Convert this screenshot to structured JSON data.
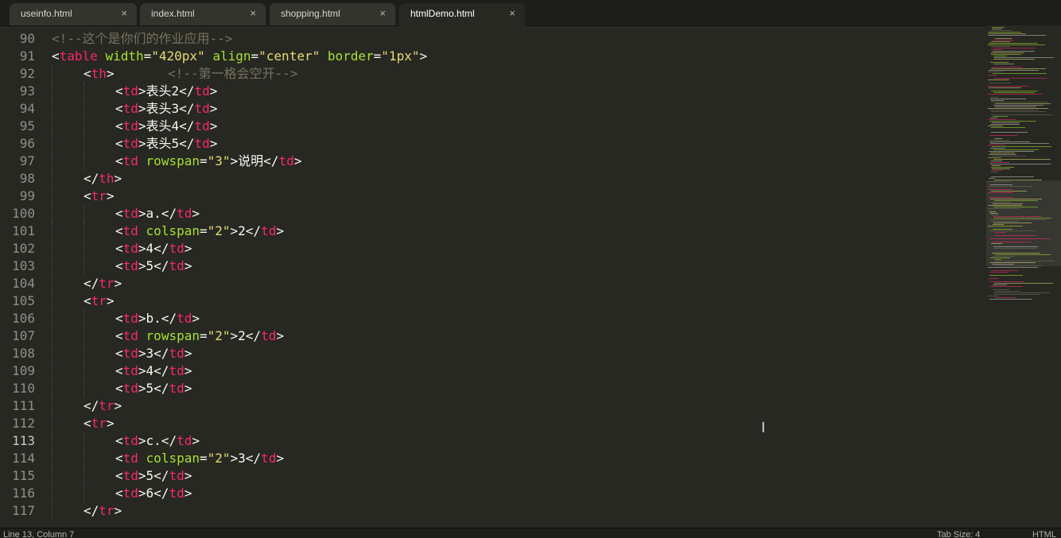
{
  "tabs": [
    {
      "label": "useinfo.html",
      "close_icon": "×",
      "active": false
    },
    {
      "label": "index.html",
      "close_icon": "×",
      "active": false
    },
    {
      "label": "shopping.html",
      "close_icon": "×",
      "active": false
    },
    {
      "label": "htmlDemo.html",
      "close_icon": "×",
      "active": true
    }
  ],
  "editor": {
    "current_line": 113,
    "lines": [
      {
        "no": "90",
        "indent": 0,
        "tokens": [
          [
            "cmt",
            "<!--这个是你们的作业应用-->"
          ]
        ]
      },
      {
        "no": "91",
        "indent": 0,
        "tokens": [
          [
            "txt",
            "<"
          ],
          [
            "tag",
            "table"
          ],
          [
            "txt",
            " "
          ],
          [
            "attr",
            "width"
          ],
          [
            "txt",
            "="
          ],
          [
            "str",
            "\"420px\""
          ],
          [
            "txt",
            " "
          ],
          [
            "attr",
            "align"
          ],
          [
            "txt",
            "="
          ],
          [
            "str",
            "\"center\""
          ],
          [
            "txt",
            " "
          ],
          [
            "attr",
            "border"
          ],
          [
            "txt",
            "="
          ],
          [
            "str",
            "\"1px\""
          ],
          [
            "txt",
            ">"
          ]
        ]
      },
      {
        "no": "92",
        "indent": 1,
        "tokens": [
          [
            "txt",
            "<"
          ],
          [
            "tag",
            "th"
          ],
          [
            "txt",
            ">"
          ],
          [
            "txt",
            "       "
          ],
          [
            "cmt",
            "<!--第一格会空开-->"
          ]
        ]
      },
      {
        "no": "93",
        "indent": 2,
        "tokens": [
          [
            "txt",
            "<"
          ],
          [
            "tag",
            "td"
          ],
          [
            "txt",
            ">表头2</"
          ],
          [
            "tag",
            "td"
          ],
          [
            "txt",
            ">"
          ]
        ]
      },
      {
        "no": "94",
        "indent": 2,
        "tokens": [
          [
            "txt",
            "<"
          ],
          [
            "tag",
            "td"
          ],
          [
            "txt",
            ">表头3</"
          ],
          [
            "tag",
            "td"
          ],
          [
            "txt",
            ">"
          ]
        ]
      },
      {
        "no": "95",
        "indent": 2,
        "tokens": [
          [
            "txt",
            "<"
          ],
          [
            "tag",
            "td"
          ],
          [
            "txt",
            ">表头4</"
          ],
          [
            "tag",
            "td"
          ],
          [
            "txt",
            ">"
          ]
        ]
      },
      {
        "no": "96",
        "indent": 2,
        "tokens": [
          [
            "txt",
            "<"
          ],
          [
            "tag",
            "td"
          ],
          [
            "txt",
            ">表头5</"
          ],
          [
            "tag",
            "td"
          ],
          [
            "txt",
            ">"
          ]
        ]
      },
      {
        "no": "97",
        "indent": 2,
        "tokens": [
          [
            "txt",
            "<"
          ],
          [
            "tag",
            "td"
          ],
          [
            "txt",
            " "
          ],
          [
            "attr",
            "rowspan"
          ],
          [
            "txt",
            "="
          ],
          [
            "str",
            "\"3\""
          ],
          [
            "txt",
            ">说明</"
          ],
          [
            "tag",
            "td"
          ],
          [
            "txt",
            ">"
          ]
        ]
      },
      {
        "no": "98",
        "indent": 1,
        "tokens": [
          [
            "txt",
            "</"
          ],
          [
            "tag",
            "th"
          ],
          [
            "txt",
            ">"
          ]
        ]
      },
      {
        "no": "99",
        "indent": 1,
        "tokens": [
          [
            "txt",
            "<"
          ],
          [
            "tag",
            "tr"
          ],
          [
            "txt",
            ">"
          ]
        ]
      },
      {
        "no": "100",
        "indent": 2,
        "tokens": [
          [
            "txt",
            "<"
          ],
          [
            "tag",
            "td"
          ],
          [
            "txt",
            ">a.</"
          ],
          [
            "tag",
            "td"
          ],
          [
            "txt",
            ">"
          ]
        ]
      },
      {
        "no": "101",
        "indent": 2,
        "tokens": [
          [
            "txt",
            "<"
          ],
          [
            "tag",
            "td"
          ],
          [
            "txt",
            " "
          ],
          [
            "attr",
            "colspan"
          ],
          [
            "txt",
            "="
          ],
          [
            "str",
            "\"2\""
          ],
          [
            "txt",
            ">2</"
          ],
          [
            "tag",
            "td"
          ],
          [
            "txt",
            ">"
          ]
        ]
      },
      {
        "no": "102",
        "indent": 2,
        "tokens": [
          [
            "txt",
            "<"
          ],
          [
            "tag",
            "td"
          ],
          [
            "txt",
            ">4</"
          ],
          [
            "tag",
            "td"
          ],
          [
            "txt",
            ">"
          ]
        ]
      },
      {
        "no": "103",
        "indent": 2,
        "tokens": [
          [
            "txt",
            "<"
          ],
          [
            "tag",
            "td"
          ],
          [
            "txt",
            ">5</"
          ],
          [
            "tag",
            "td"
          ],
          [
            "txt",
            ">"
          ]
        ]
      },
      {
        "no": "104",
        "indent": 1,
        "tokens": [
          [
            "txt",
            "</"
          ],
          [
            "tag",
            "tr"
          ],
          [
            "txt",
            ">"
          ]
        ]
      },
      {
        "no": "105",
        "indent": 1,
        "tokens": [
          [
            "txt",
            "<"
          ],
          [
            "tag",
            "tr"
          ],
          [
            "txt",
            ">"
          ]
        ]
      },
      {
        "no": "106",
        "indent": 2,
        "tokens": [
          [
            "txt",
            "<"
          ],
          [
            "tag",
            "td"
          ],
          [
            "txt",
            ">b.</"
          ],
          [
            "tag",
            "td"
          ],
          [
            "txt",
            ">"
          ]
        ]
      },
      {
        "no": "107",
        "indent": 2,
        "tokens": [
          [
            "txt",
            "<"
          ],
          [
            "tag",
            "td"
          ],
          [
            "txt",
            " "
          ],
          [
            "attr",
            "rowspan"
          ],
          [
            "txt",
            "="
          ],
          [
            "str",
            "\"2\""
          ],
          [
            "txt",
            ">2</"
          ],
          [
            "tag",
            "td"
          ],
          [
            "txt",
            ">"
          ]
        ]
      },
      {
        "no": "108",
        "indent": 2,
        "tokens": [
          [
            "txt",
            "<"
          ],
          [
            "tag",
            "td"
          ],
          [
            "txt",
            ">3</"
          ],
          [
            "tag",
            "td"
          ],
          [
            "txt",
            ">"
          ]
        ]
      },
      {
        "no": "109",
        "indent": 2,
        "tokens": [
          [
            "txt",
            "<"
          ],
          [
            "tag",
            "td"
          ],
          [
            "txt",
            ">4</"
          ],
          [
            "tag",
            "td"
          ],
          [
            "txt",
            ">"
          ]
        ]
      },
      {
        "no": "110",
        "indent": 2,
        "tokens": [
          [
            "txt",
            "<"
          ],
          [
            "tag",
            "td"
          ],
          [
            "txt",
            ">5</"
          ],
          [
            "tag",
            "td"
          ],
          [
            "txt",
            ">"
          ]
        ]
      },
      {
        "no": "111",
        "indent": 1,
        "tokens": [
          [
            "txt",
            "</"
          ],
          [
            "tag",
            "tr"
          ],
          [
            "txt",
            ">"
          ]
        ]
      },
      {
        "no": "112",
        "indent": 1,
        "tokens": [
          [
            "txt",
            "<"
          ],
          [
            "tag",
            "tr"
          ],
          [
            "txt",
            ">"
          ]
        ]
      },
      {
        "no": "113",
        "indent": 2,
        "tokens": [
          [
            "txt",
            "<"
          ],
          [
            "tag",
            "td"
          ],
          [
            "txt",
            ">c.</"
          ],
          [
            "tag",
            "td"
          ],
          [
            "txt",
            ">"
          ]
        ]
      },
      {
        "no": "114",
        "indent": 2,
        "tokens": [
          [
            "txt",
            "<"
          ],
          [
            "tag",
            "td"
          ],
          [
            "txt",
            " "
          ],
          [
            "attr",
            "colspan"
          ],
          [
            "txt",
            "="
          ],
          [
            "str",
            "\"2\""
          ],
          [
            "txt",
            ">3</"
          ],
          [
            "tag",
            "td"
          ],
          [
            "txt",
            ">"
          ]
        ]
      },
      {
        "no": "115",
        "indent": 2,
        "tokens": [
          [
            "txt",
            "<"
          ],
          [
            "tag",
            "td"
          ],
          [
            "txt",
            ">5</"
          ],
          [
            "tag",
            "td"
          ],
          [
            "txt",
            ">"
          ]
        ]
      },
      {
        "no": "116",
        "indent": 2,
        "tokens": [
          [
            "txt",
            "<"
          ],
          [
            "tag",
            "td"
          ],
          [
            "txt",
            ">6</"
          ],
          [
            "tag",
            "td"
          ],
          [
            "txt",
            ">"
          ]
        ]
      },
      {
        "no": "117",
        "indent": 1,
        "tokens": [
          [
            "txt",
            "</"
          ],
          [
            "tag",
            "tr"
          ],
          [
            "txt",
            ">"
          ]
        ]
      }
    ]
  },
  "status": {
    "position": "Line 13, Column 7",
    "tab_size": "Tab Size: 4",
    "syntax": "HTML"
  },
  "colors": {
    "background": "#272822",
    "tag": "#f92672",
    "attribute": "#a6e22e",
    "string": "#e6db74",
    "comment": "#75715e",
    "text": "#f8f8f2"
  }
}
